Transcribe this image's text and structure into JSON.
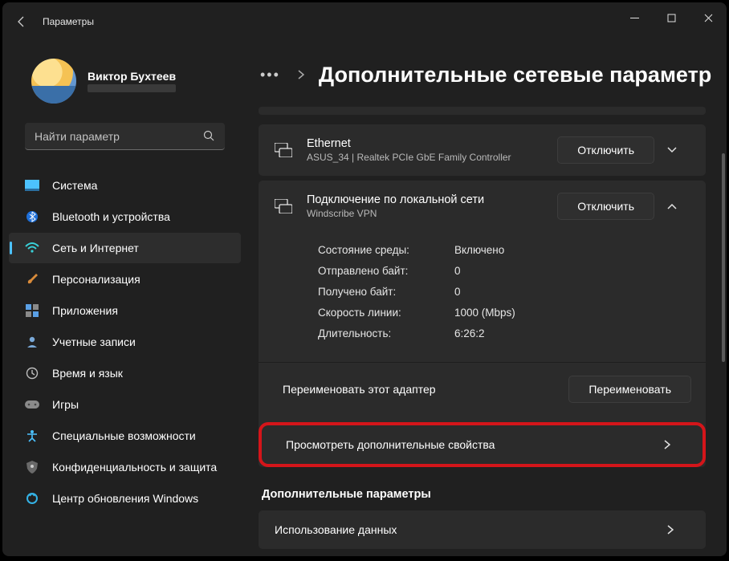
{
  "window": {
    "title": "Параметры"
  },
  "profile": {
    "name": "Виктор Бухтеев"
  },
  "search": {
    "placeholder": "Найти параметр"
  },
  "nav": {
    "items": [
      {
        "label": "Система"
      },
      {
        "label": "Bluetooth и устройства"
      },
      {
        "label": "Сеть и Интернет"
      },
      {
        "label": "Персонализация"
      },
      {
        "label": "Приложения"
      },
      {
        "label": "Учетные записи"
      },
      {
        "label": "Время и язык"
      },
      {
        "label": "Игры"
      },
      {
        "label": "Специальные возможности"
      },
      {
        "label": "Конфиденциальность и защита"
      },
      {
        "label": "Центр обновления Windows"
      }
    ]
  },
  "page": {
    "title": "Дополнительные сетевые параметр"
  },
  "adapters": {
    "ethernet": {
      "title": "Ethernet",
      "sub": "ASUS_34 | Realtek PCIe GbE Family Controller",
      "action": "Отключить"
    },
    "local": {
      "title": "Подключение по локальной сети",
      "sub": "Windscribe VPN",
      "action": "Отключить",
      "stats": {
        "media_label": "Состояние среды:",
        "media_val": "Включено",
        "sent_label": "Отправлено байт:",
        "sent_val": "0",
        "recv_label": "Получено байт:",
        "recv_val": "0",
        "speed_label": "Скорость линии:",
        "speed_val": "1000 (Mbps)",
        "dur_label": "Длительность:",
        "dur_val": "6:26:2"
      },
      "rename_label": "Переименовать этот адаптер",
      "rename_btn": "Переименовать",
      "view_more": "Просмотреть дополнительные свойства"
    }
  },
  "extra": {
    "header": "Дополнительные параметры",
    "data_usage": "Использование данных"
  }
}
